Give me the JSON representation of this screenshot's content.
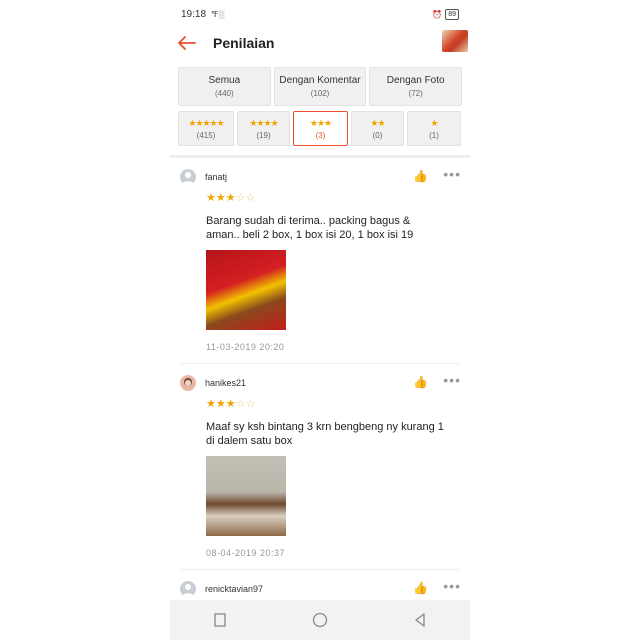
{
  "status_bar": {
    "time": "19:18",
    "signal": "℉░",
    "alarm_icon": "alarm-icon",
    "battery": "89"
  },
  "header": {
    "title": "Penilaian",
    "back_icon": "back-arrow-icon"
  },
  "filters": [
    {
      "label": "Semua",
      "count": "(440)"
    },
    {
      "label": "Dengan Komentar",
      "count": "(102)"
    },
    {
      "label": "Dengan Foto",
      "count": "(72)"
    }
  ],
  "star_filters": [
    {
      "stars": "★★★★★",
      "count": "(415)",
      "active": false
    },
    {
      "stars": "★★★★",
      "count": "(19)",
      "active": false
    },
    {
      "stars": "★★★",
      "count": "(3)",
      "active": true
    },
    {
      "stars": "★★",
      "count": "(0)",
      "active": false
    },
    {
      "stars": "★",
      "count": "(1)",
      "active": false
    }
  ],
  "reviews": [
    {
      "username": "fanatj",
      "rating": 3,
      "stars_on": "★★★",
      "stars_off": "☆☆",
      "comment": "Barang sudah di terima.. packing bagus & aman.. beli 2 box, 1 box isi 20, 1 box isi 19",
      "date": "11-03-2019 20:20"
    },
    {
      "username": "hanikes21",
      "rating": 3,
      "stars_on": "★★★",
      "stars_off": "☆☆",
      "comment": "Maaf sy ksh bintang 3 krn bengbeng ny kurang 1 di dalem satu box",
      "date": "08-04-2019 20:37"
    },
    {
      "username": "renicktavian97"
    }
  ],
  "colors": {
    "accent": "#ee4d2d",
    "star": "#f0a400"
  }
}
